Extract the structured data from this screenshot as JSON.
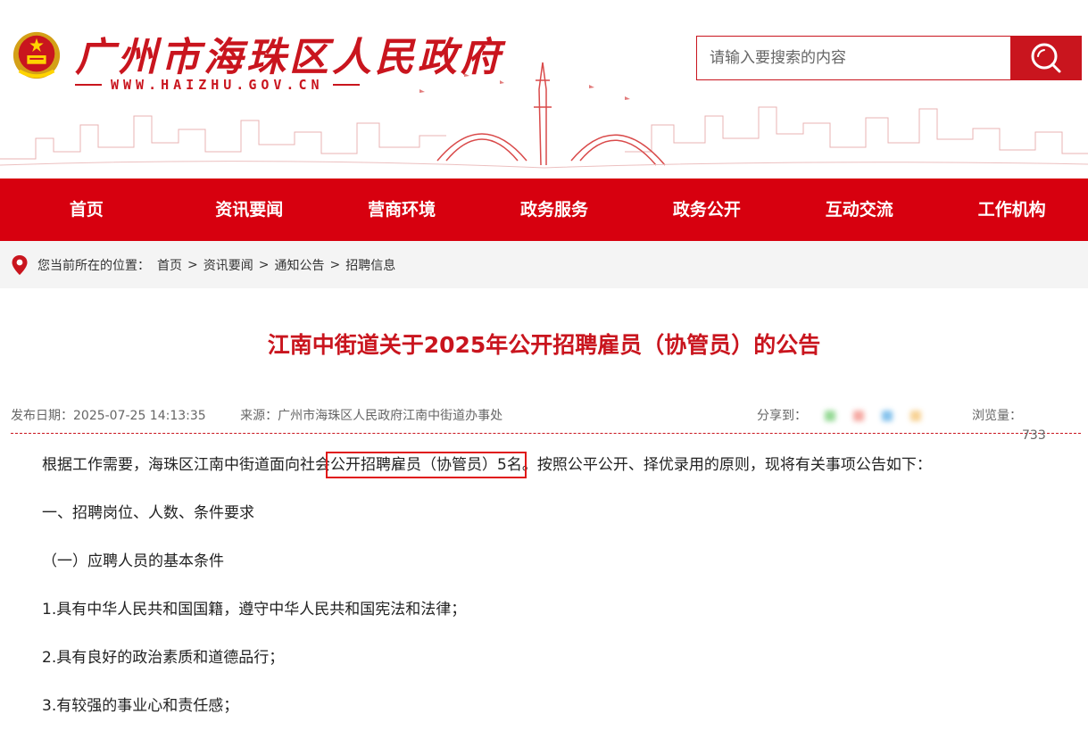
{
  "site": {
    "title": "广州市海珠区人民政府",
    "url": "WWW.HAIZHU.GOV.CN"
  },
  "search": {
    "placeholder": "请输入要搜索的内容"
  },
  "nav": {
    "items": [
      "首页",
      "资讯要闻",
      "营商环境",
      "政务服务",
      "政务公开",
      "互动交流",
      "工作机构"
    ]
  },
  "breadcrumb": {
    "prefix": "您当前所在的位置：",
    "items": [
      "首页",
      "资讯要闻",
      "通知公告",
      "招聘信息"
    ],
    "separator": ">"
  },
  "article": {
    "title": "江南中街道关于2025年公开招聘雇员（协管员）的公告",
    "publish_label": "发布日期：",
    "publish_date": "2025-07-25 14:13:35",
    "source_label": "来源：",
    "source": "广州市海珠区人民政府江南中街道办事处",
    "share_label": "分享到：",
    "views_label": "浏览量：",
    "views": "733",
    "paragraphs": {
      "p1_before": "根据工作需要，海珠区江南中街道面向社会",
      "p1_highlight": "公开招聘雇员（协管员）5名",
      "p1_after": "。按照公平公开、择优录用的原则，现将有关事项公告如下：",
      "p2": "一、招聘岗位、人数、条件要求",
      "p3": "（一）应聘人员的基本条件",
      "p4": "1.具有中华人民共和国国籍，遵守中华人民共和国宪法和法律；",
      "p5": "2.具有良好的政治素质和道德品行；",
      "p6": "3.有较强的事业心和责任感；"
    }
  },
  "colors": {
    "brand_red": "#c9151e",
    "nav_red": "#d7000f",
    "highlight_box": "#e01818"
  }
}
